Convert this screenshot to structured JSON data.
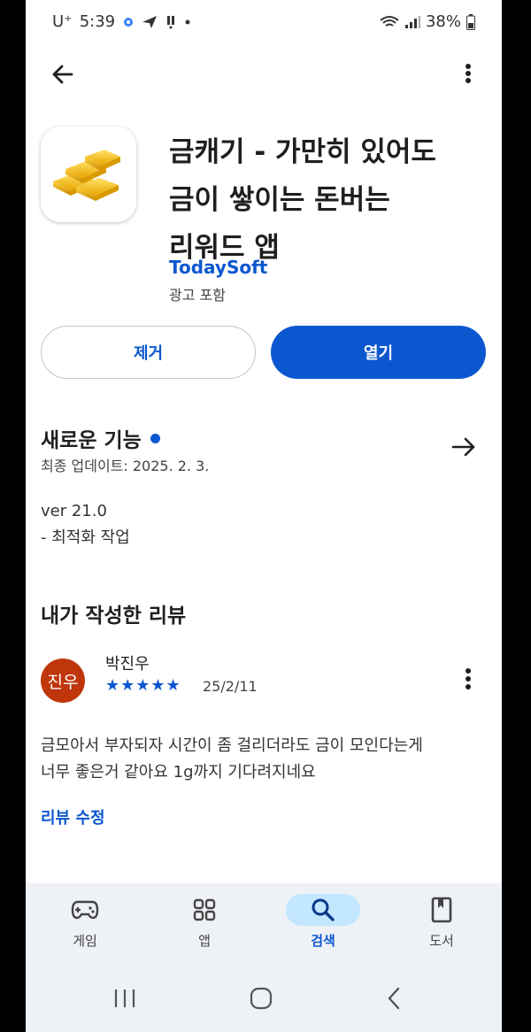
{
  "status": {
    "carrier": "U⁺",
    "time": "5:39",
    "battery": "38%"
  },
  "app": {
    "title_lines": [
      "금캐기 - 가만히 있어도",
      "금이 쌓이는 돈버는",
      "리워드 앱"
    ],
    "developer": "TodaySoft",
    "ads": "광고 포함"
  },
  "actions": {
    "remove": "제거",
    "open": "열기"
  },
  "whats_new": {
    "title": "새로운 기능",
    "updated": "최종 업데이트: 2025. 2. 3.",
    "notes": [
      "ver 21.0",
      "- 최적화 작업"
    ]
  },
  "my_review": {
    "title": "내가 작성한 리뷰",
    "avatar_text": "진우",
    "reviewer": "박진우",
    "stars": "★★★★★",
    "rating": 5,
    "date": "25/2/11",
    "text_lines": [
      "금모아서 부자되자 시간이 좀 걸리더라도 금이 모인다는게",
      "너무 좋은거 같아요 1g까지 기다려지네요"
    ],
    "edit": "리뷰 수정"
  },
  "bottom_nav": [
    {
      "label": "게임",
      "icon": "gamepad-icon",
      "active": false
    },
    {
      "label": "앱",
      "icon": "apps-grid-icon",
      "active": false
    },
    {
      "label": "검색",
      "icon": "search-icon",
      "active": true
    },
    {
      "label": "도서",
      "icon": "book-icon",
      "active": false
    }
  ],
  "colors": {
    "accent": "#0b57d0",
    "avatar": "#bf360c",
    "nav_bg": "#eef1f6",
    "nav_active": "#c2e7ff"
  }
}
